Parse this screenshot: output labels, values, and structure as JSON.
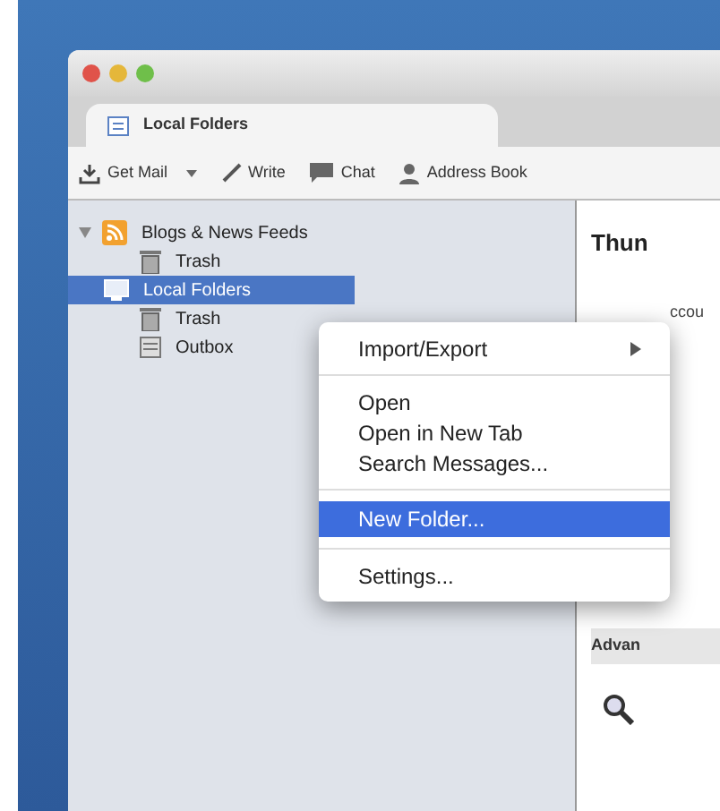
{
  "tab": {
    "label": "Local Folders",
    "selected": true
  },
  "toolbar": [
    {
      "label": "Get Mail",
      "kind": "split"
    },
    {
      "label": "Write",
      "kind": "write"
    },
    {
      "label": "Chat",
      "kind": "chat"
    },
    {
      "label": "Address Book",
      "kind": "contacts"
    }
  ],
  "folders": [
    {
      "label": "Blogs & News Feeds",
      "kind": "feeds",
      "selected": false,
      "children": [
        {
          "label": "Trash",
          "kind": "trash",
          "selected": false
        }
      ]
    },
    {
      "label": "Local Folders",
      "kind": "local",
      "selected": true,
      "children": [
        {
          "label": "Trash",
          "kind": "trash",
          "selected": false
        },
        {
          "label": "Outbox",
          "kind": "outbox",
          "selected": false
        }
      ]
    }
  ],
  "pane": {
    "title": "Thun",
    "section_1": "ccou",
    "section_2": "Advan"
  },
  "context_menu": [
    {
      "kind": "submenu",
      "label": "Import/Export",
      "selected": false
    },
    {
      "kind": "separator"
    },
    {
      "kind": "item",
      "label": "Open",
      "selected": false
    },
    {
      "kind": "item",
      "label": "Open in New Tab",
      "selected": false
    },
    {
      "kind": "item",
      "label": "Search Messages...",
      "selected": false
    },
    {
      "kind": "separator"
    },
    {
      "kind": "item",
      "label": "New Folder...",
      "selected": true
    },
    {
      "kind": "separator"
    },
    {
      "kind": "item",
      "label": "Settings...",
      "selected": false
    }
  ]
}
